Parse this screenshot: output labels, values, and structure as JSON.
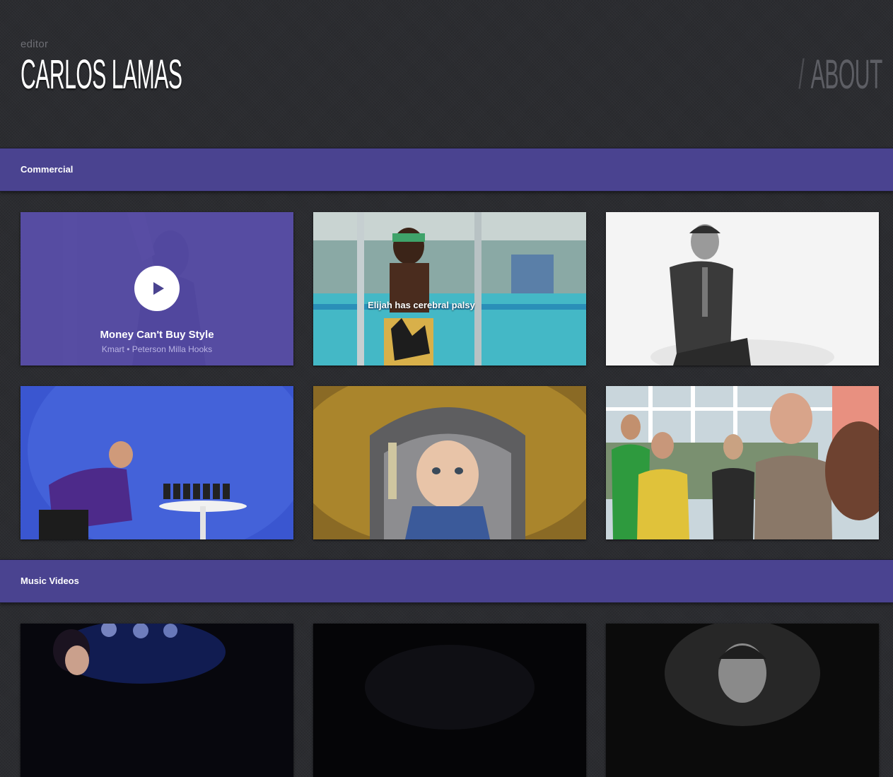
{
  "header": {
    "role": "editor",
    "name": "CARLOS LAMAS",
    "about_slash": "/",
    "about_label": "ABOUT"
  },
  "sections": [
    {
      "label": "Commercial",
      "tiles": [
        {
          "title": "Money Can't Buy Style",
          "client": "Kmart",
          "separator": "•",
          "agency": "Peterson Milla Hooks",
          "state": "hover"
        },
        {
          "caption": "Elijah has cerebral palsy"
        },
        {},
        {},
        {},
        {}
      ]
    },
    {
      "label": "Music Videos",
      "tiles": [
        {},
        {},
        {}
      ]
    }
  ],
  "icons": {
    "play": "play-icon"
  },
  "colors": {
    "accent": "#4a4390",
    "hover_overlay": "#544aa8",
    "background": "#2b2c30"
  }
}
